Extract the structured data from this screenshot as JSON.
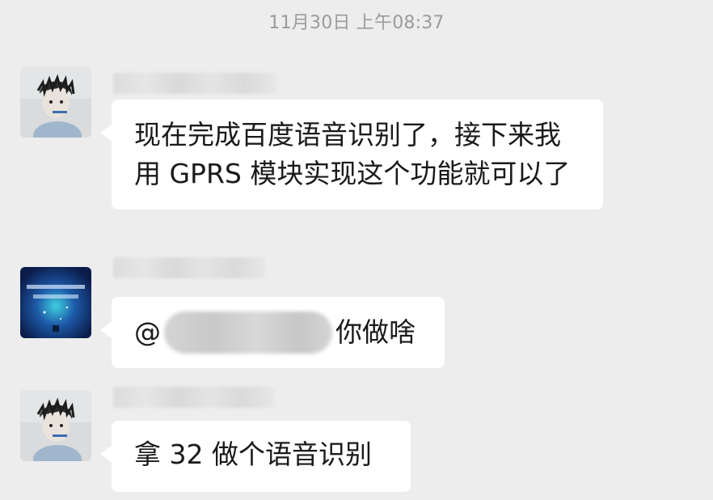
{
  "timestamp": "11月30日 上午08:37",
  "messages": [
    {
      "sender": "user-1",
      "text": "现在完成百度语音识别了，接下来我用 GPRS 模块实现这个功能就可以了"
    },
    {
      "sender": "user-2",
      "at_symbol": "@",
      "text": "你做啥"
    },
    {
      "sender": "user-1",
      "text": "拿 32 做个语音识别"
    }
  ]
}
